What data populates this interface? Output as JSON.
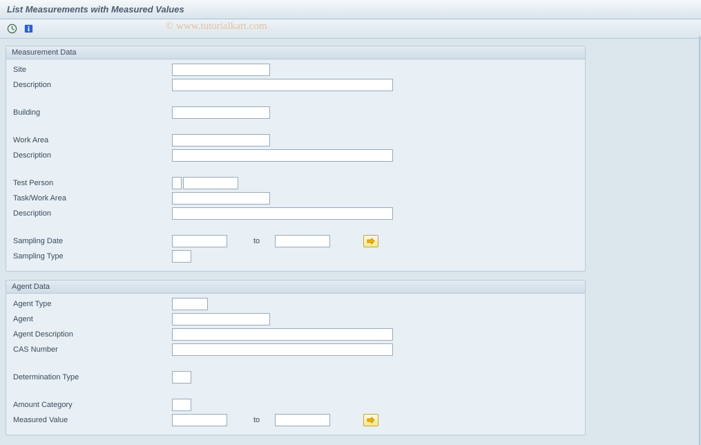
{
  "title": "List Measurements with Measured Values",
  "watermark": "© www.tutorialkart.com",
  "icons": {
    "execute": "execute-clock-icon",
    "info": "info-icon"
  },
  "groups": {
    "measurement": {
      "title": "Measurement Data",
      "fields": {
        "site": "Site",
        "description1": "Description",
        "building": "Building",
        "workArea": "Work Area",
        "description2": "Description",
        "testPerson": "Test Person",
        "taskWorkArea": "Task/Work Area",
        "description3": "Description",
        "samplingDate": "Sampling Date",
        "to": "to",
        "samplingType": "Sampling Type"
      }
    },
    "agent": {
      "title": "Agent Data",
      "fields": {
        "agentType": "Agent Type",
        "agent": "Agent",
        "agentDescription": "Agent Description",
        "casNumber": "CAS Number",
        "determinationType": "Determination Type",
        "amountCategory": "Amount Category",
        "measuredValue": "Measured Value",
        "to": "to"
      }
    }
  }
}
